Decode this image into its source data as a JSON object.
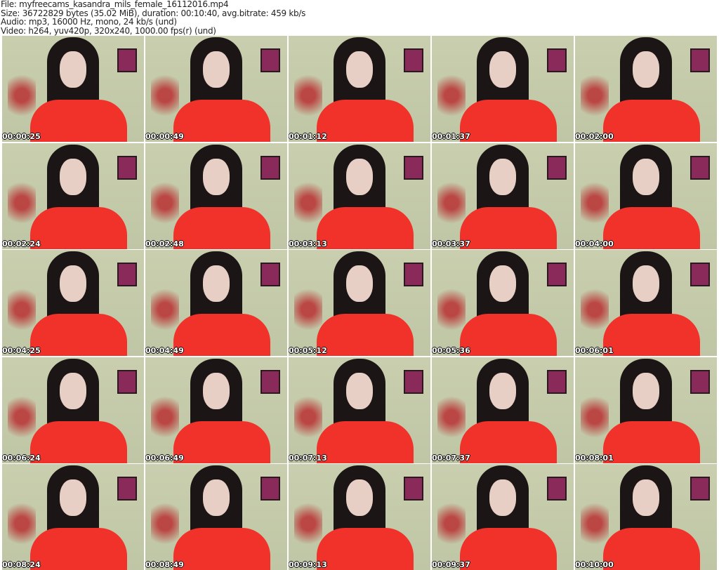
{
  "info": {
    "file": "File: myfreecams_kasandra_mils_female_16112016.mp4",
    "size": "Size: 36722829 bytes (35.02 MiB), duration: 00:10:40, avg.bitrate: 459 kb/s",
    "audio": "Audio: mp3, 16000 Hz, mono, 24 kb/s (und)",
    "video": "Video: h264, yuv420p, 320x240, 1000.00 fps(r) (und)"
  },
  "timestamps": [
    "00:00:25",
    "00:00:49",
    "00:01:12",
    "00:01:37",
    "00:02:00",
    "00:02:24",
    "00:02:48",
    "00:03:13",
    "00:03:37",
    "00:04:00",
    "00:04:25",
    "00:04:49",
    "00:05:12",
    "00:05:36",
    "00:06:01",
    "00:06:24",
    "00:06:49",
    "00:07:13",
    "00:07:37",
    "00:08:01",
    "00:08:24",
    "00:08:49",
    "00:09:13",
    "00:09:37",
    "00:10:00"
  ]
}
